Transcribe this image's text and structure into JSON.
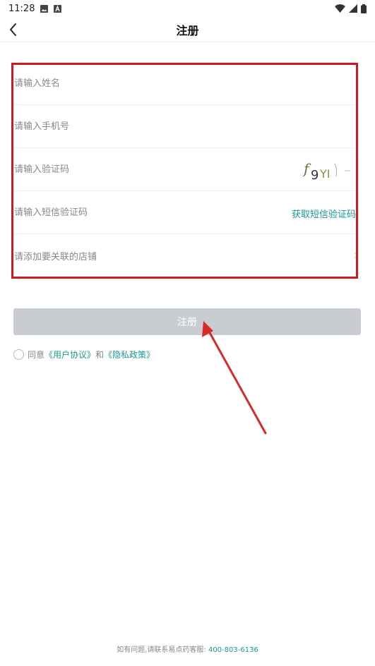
{
  "status_bar": {
    "time": "11:28",
    "icons_left": [
      "image-icon",
      "font-icon"
    ],
    "icons_right": [
      "wifi-icon",
      "signal-icon",
      "battery-icon"
    ]
  },
  "nav": {
    "title": "注册",
    "back_icon": "chevron-left-icon"
  },
  "form": {
    "name_placeholder": "请输入姓名",
    "phone_placeholder": "请输入手机号",
    "captcha_placeholder": "请输入验证码",
    "captcha_text": "f9YI",
    "sms_placeholder": "请输入短信验证码",
    "sms_link": "获取短信验证码",
    "store_label": "请添加要关联的店铺"
  },
  "submit_label": "注册",
  "agreement": {
    "prefix": "同意",
    "user_agreement": "《用户协议》",
    "and": "和",
    "privacy_policy": "《隐私政策》"
  },
  "footer": {
    "text": "如有问题,请联系易点药客服:",
    "phone": "400-803-6136"
  },
  "colors": {
    "accent": "#1a9a8f",
    "highlight_border": "#d01a21",
    "button_disabled": "#c9ccd1"
  }
}
